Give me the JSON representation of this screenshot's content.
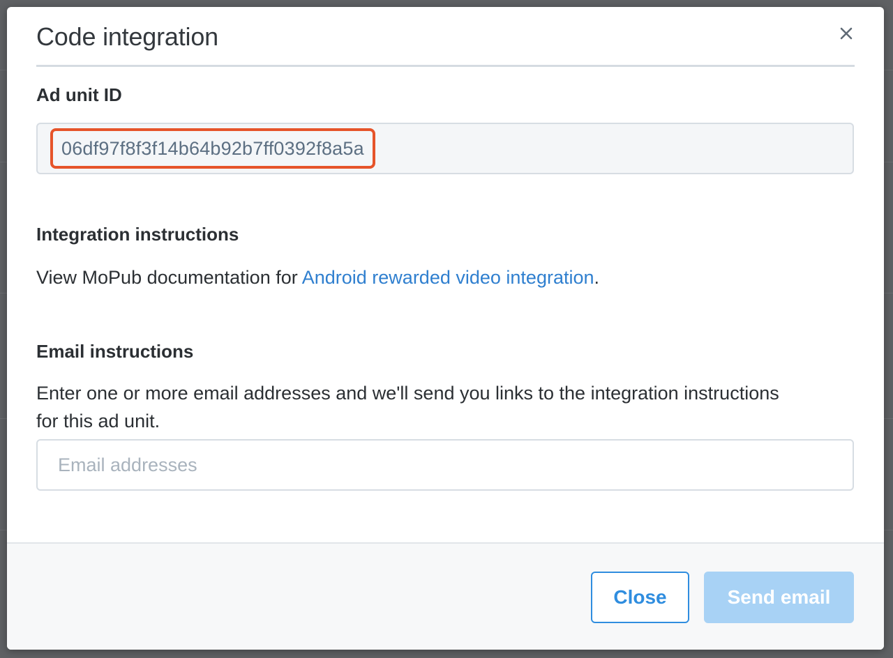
{
  "modal": {
    "title": "Code integration",
    "close_icon": "close-icon"
  },
  "ad_unit": {
    "label": "Ad unit ID",
    "value": "06df97f8f3f14b64b92b7ff0392f8a5a",
    "highlight_color": "#e6542a"
  },
  "integration": {
    "label": "Integration instructions",
    "text_before": "View MoPub documentation for ",
    "link_text": "Android rewarded video integration",
    "text_after": "."
  },
  "email": {
    "label": "Email instructions",
    "description_line1": "Enter one or more email addresses and we'll send you links to the integration instructions",
    "description_line2": "for this ad unit.",
    "placeholder": "Email addresses",
    "value": ""
  },
  "footer": {
    "close_label": "Close",
    "send_label": "Send email"
  },
  "colors": {
    "link": "#2f7fcf",
    "primary": "#2f8ddf",
    "primary_disabled": "#a8d2f5"
  }
}
